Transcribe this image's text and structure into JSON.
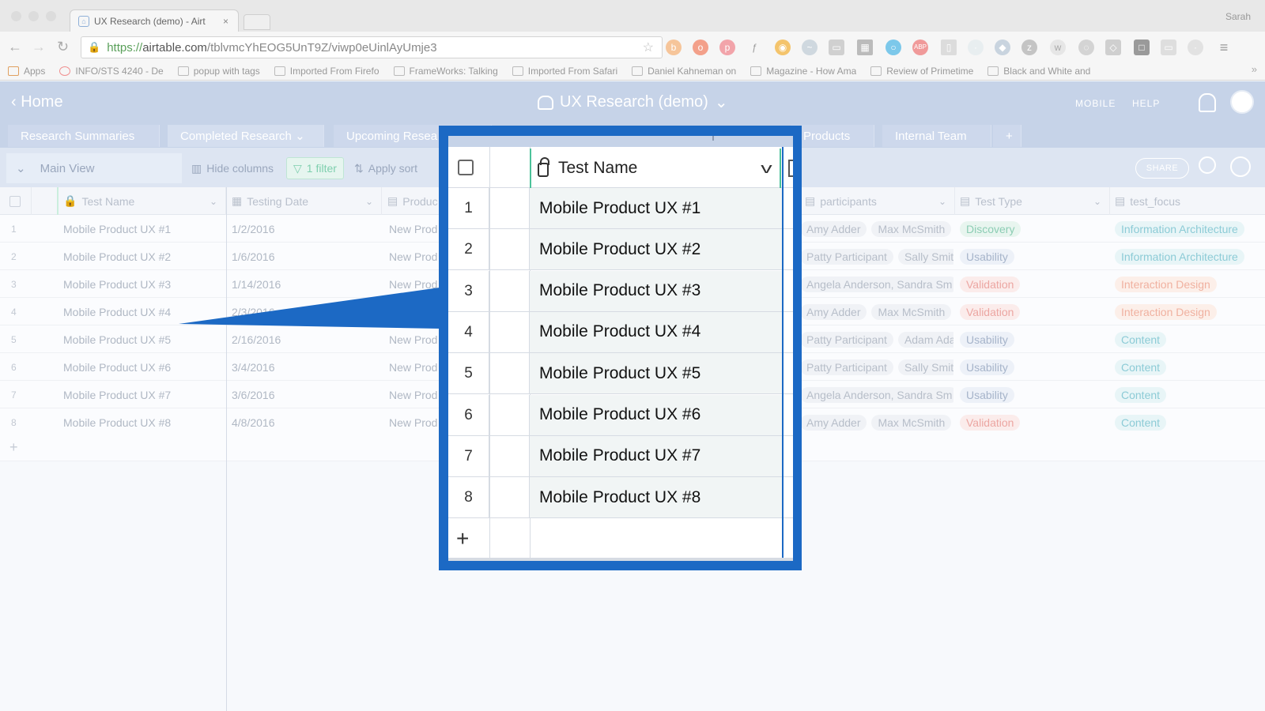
{
  "browser": {
    "tab_title": "UX Research (demo) - Airt",
    "tab_close": "×",
    "profile": "Sarah",
    "url_proto": "https://",
    "url_host": "airtable.com",
    "url_path": "/tblvmcYhEOG5UnT9Z/viwp0eUinlAyUmje3",
    "bookmarks": [
      "Apps",
      "INFO/STS 4240 - De",
      "popup with tags",
      "Imported From Firefo",
      "FrameWorks: Talking",
      "Imported From Safari",
      "Daniel Kahneman on",
      "Magazine - How Ama",
      "Review of Primetime",
      "Black and White and"
    ],
    "bookmarks_more": "»"
  },
  "app": {
    "home": "Home",
    "base_title": "UX Research (demo)",
    "mobile": "MOBILE",
    "help": "HELP",
    "accent": "#c6d3e8"
  },
  "tables": [
    "Research Summaries",
    "Completed Research",
    "Upcoming Resea",
    "Products",
    "Internal Team",
    "+"
  ],
  "toolbar": {
    "view": "Main View",
    "hide_columns": "Hide columns",
    "filter": "1 filter",
    "apply_sort": "Apply sort",
    "share": "SHARE"
  },
  "grid": {
    "columns": {
      "test_name": "Test Name",
      "testing_date": "Testing Date",
      "product": "Produc",
      "participants": "participants",
      "test_type": "Test Type",
      "test_focus": "test_focus"
    },
    "rows": [
      {
        "num": "1",
        "name": "Mobile Product UX #1",
        "date": "1/2/2016",
        "product": "New Prod",
        "p1": "Amy Adder",
        "p2": "Max McSmith",
        "type": "Discovery",
        "focus": "Information Architecture"
      },
      {
        "num": "2",
        "name": "Mobile Product UX #2",
        "date": "1/6/2016",
        "product": "New Prod",
        "p1": "Patty Participant",
        "p2": "Sally Smitl",
        "type": "Usability",
        "focus": "Information Architecture"
      },
      {
        "num": "3",
        "name": "Mobile Product UX #3",
        "date": "1/14/2016",
        "product": "New Prod",
        "p1": "Angela Anderson, Sandra Sm",
        "p2": "",
        "type": "Validation",
        "focus": "Interaction Design"
      },
      {
        "num": "4",
        "name": "Mobile Product UX #4",
        "date": "2/3/2016",
        "product": "",
        "p1": "Amy Adder",
        "p2": "Max McSmith",
        "type": "Validation",
        "focus": "Interaction Design"
      },
      {
        "num": "5",
        "name": "Mobile Product UX #5",
        "date": "2/16/2016",
        "product": "New Prod",
        "p1": "Patty Participant",
        "p2": "Adam Ada",
        "type": "Usability",
        "focus": "Content"
      },
      {
        "num": "6",
        "name": "Mobile Product UX #6",
        "date": "3/4/2016",
        "product": "New Prod",
        "p1": "Patty Participant",
        "p2": "Sally Smitl",
        "type": "Usability",
        "focus": "Content"
      },
      {
        "num": "7",
        "name": "Mobile Product UX #7",
        "date": "3/6/2016",
        "product": "New Prod",
        "p1": "Angela Anderson, Sandra Sm",
        "p2": "",
        "type": "Usability",
        "focus": "Content"
      },
      {
        "num": "8",
        "name": "Mobile Product UX #8",
        "date": "4/8/2016",
        "product": "New Prod",
        "p1": "Amy Adder",
        "p2": "Max McSmith",
        "type": "Validation",
        "focus": "Content"
      }
    ],
    "add_row": "+"
  },
  "zoom": {
    "header": "Test Name",
    "rows": [
      {
        "num": "1",
        "name": "Mobile Product UX #1"
      },
      {
        "num": "2",
        "name": "Mobile Product UX #2"
      },
      {
        "num": "3",
        "name": "Mobile Product UX #3"
      },
      {
        "num": "4",
        "name": "Mobile Product UX #4"
      },
      {
        "num": "5",
        "name": "Mobile Product UX #5"
      },
      {
        "num": "6",
        "name": "Mobile Product UX #6"
      },
      {
        "num": "7",
        "name": "Mobile Product UX #7"
      },
      {
        "num": "8",
        "name": "Mobile Product UX #8"
      }
    ],
    "add_row": "+",
    "frame_color": "#1c69c4"
  }
}
